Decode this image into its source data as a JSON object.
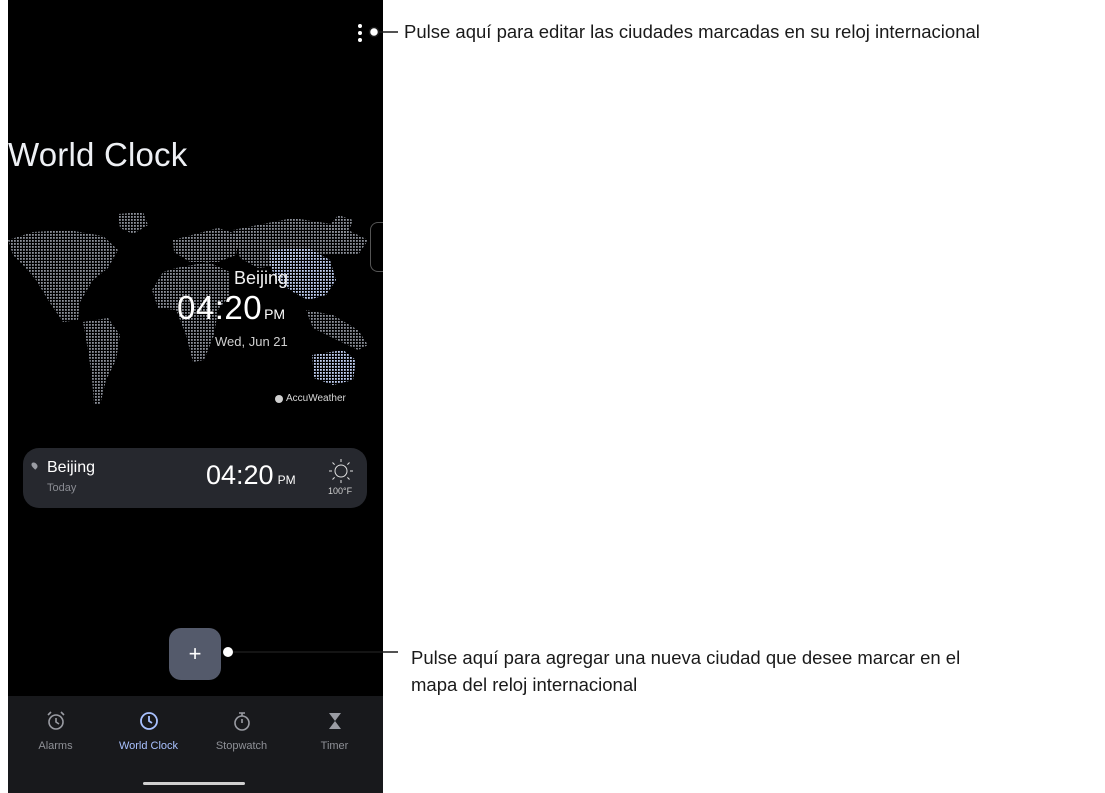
{
  "screen": {
    "title": "World Clock",
    "map": {
      "city": "Beijing",
      "time": "04:20",
      "ampm": "PM",
      "date": "Wed, Jun 21",
      "provider": "AccuWeather"
    },
    "card": {
      "city": "Beijing",
      "day": "Today",
      "time": "04:20",
      "ampm": "PM",
      "temp": "100°F",
      "weather_icon": "sun-icon"
    },
    "fab": {
      "label": "+",
      "icon": "plus-icon"
    },
    "nav": [
      {
        "label": "Alarms",
        "icon": "alarm-icon"
      },
      {
        "label": "World Clock",
        "icon": "clock-icon",
        "active": true
      },
      {
        "label": "Stopwatch",
        "icon": "stopwatch-icon"
      },
      {
        "label": "Timer",
        "icon": "hourglass-icon"
      }
    ],
    "colors": {
      "background": "#000000",
      "accent": "#a9c1ff",
      "card": "#26282e",
      "fab": "#545a6b",
      "nav_bar": "#18191c"
    }
  },
  "callouts": {
    "menu": "Pulse aquí para editar las ciudades marcadas en su reloj internacional",
    "add_line1": "Pulse aquí para agregar una nueva ciudad que desee marcar en el",
    "add_line2": "mapa del reloj internacional"
  }
}
